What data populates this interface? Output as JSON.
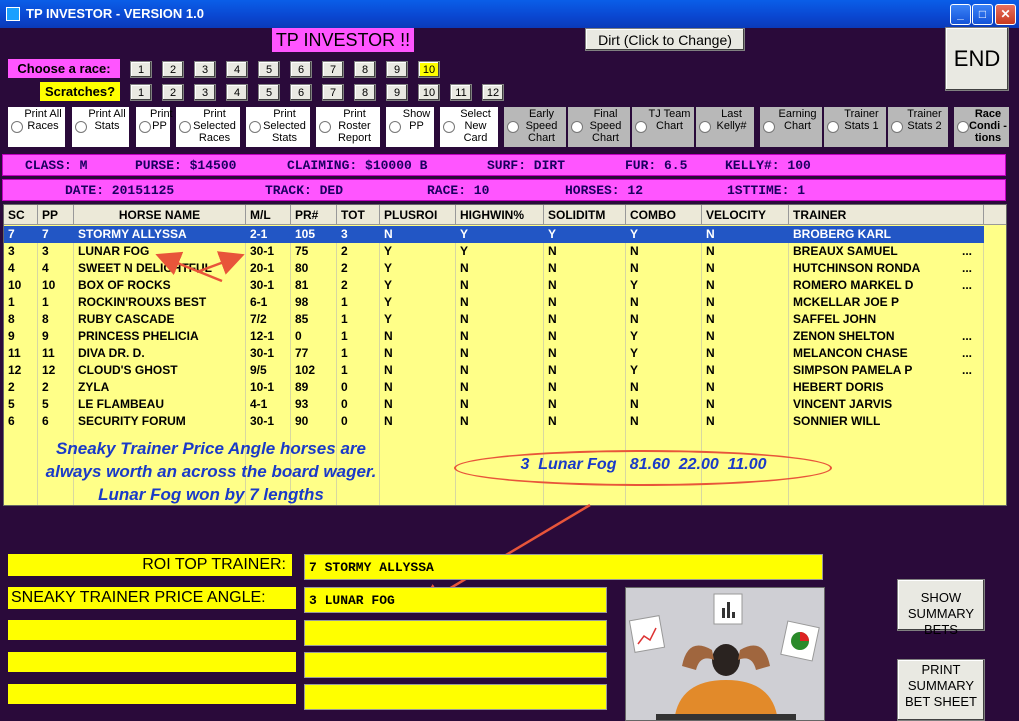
{
  "window": {
    "title": "TP INVESTOR - VERSION 1.0",
    "min": "_",
    "max": "□",
    "close": "✕"
  },
  "header": {
    "app_label": "TP INVESTOR !!",
    "dirt_button": "Dirt (Click to Change)",
    "end_button": "END",
    "choose_race_label": "Choose  a race:",
    "scratches_label": "Scratches?",
    "race_buttons": [
      "1",
      "2",
      "3",
      "4",
      "5",
      "6",
      "7",
      "8",
      "9",
      "10"
    ],
    "selected_race": "10",
    "scratch_buttons": [
      "1",
      "2",
      "3",
      "4",
      "5",
      "6",
      "7",
      "8",
      "9",
      "10",
      "11",
      "12"
    ]
  },
  "options": [
    {
      "label": "Print All Races"
    },
    {
      "label": "Print All Stats"
    },
    {
      "label": "Print PP"
    },
    {
      "label": "Print Selected Races"
    },
    {
      "label": "Print Selected Stats"
    },
    {
      "label": "Print Roster Report"
    },
    {
      "label": "Show PP"
    },
    {
      "label": "Select New Card"
    },
    {
      "label": "Early Speed Chart"
    },
    {
      "label": "Final Speed Chart"
    },
    {
      "label": "TJ Team Chart"
    },
    {
      "label": "Last Kelly#"
    },
    {
      "label": "Earning Chart"
    },
    {
      "label": "Trainer Stats 1"
    },
    {
      "label": "Trainer Stats 2"
    },
    {
      "label": "Race Condi -tions"
    }
  ],
  "info1": {
    "class": "CLASS: M",
    "purse": "PURSE: $14500",
    "claiming": "CLAIMING: $10000 B",
    "surf": "SURF: DIRT",
    "fur": "FUR: 6.5",
    "kelly": "KELLY#: 100"
  },
  "info2": {
    "date": "DATE: 20151125",
    "track": "TRACK: DED",
    "race": "RACE: 10",
    "horses": "HORSES: 12",
    "firsttime": "1STTIME: 1"
  },
  "grid": {
    "columns": [
      "SC",
      "PP",
      "HORSE NAME",
      "M/L",
      "PR#",
      "TOT",
      "PLUSROI",
      "HIGHWIN%",
      "SOLIDITM",
      "COMBO",
      "VELOCITY",
      "TRAINER"
    ],
    "rows": [
      [
        "7",
        "7",
        "STORMY ALLYSSA",
        "2-1",
        "105",
        "3",
        "N",
        "Y",
        "Y",
        "Y",
        "N",
        "BROBERG KARL",
        ""
      ],
      [
        "3",
        "3",
        "LUNAR FOG",
        "30-1",
        "75",
        "2",
        "Y",
        "Y",
        "N",
        "N",
        "N",
        "BREAUX SAMUEL",
        "..."
      ],
      [
        "4",
        "4",
        "SWEET N DELIGHTFUL",
        "20-1",
        "80",
        "2",
        "Y",
        "N",
        "N",
        "N",
        "N",
        "HUTCHINSON RONDA",
        "..."
      ],
      [
        "10",
        "10",
        "BOX OF ROCKS",
        "30-1",
        "81",
        "2",
        "Y",
        "N",
        "N",
        "Y",
        "N",
        "ROMERO MARKEL D",
        "..."
      ],
      [
        "1",
        "1",
        "ROCKIN'ROUXS BEST",
        "6-1",
        "98",
        "1",
        "Y",
        "N",
        "N",
        "N",
        "N",
        "MCKELLAR JOE P",
        ""
      ],
      [
        "8",
        "8",
        "RUBY CASCADE",
        "7/2",
        "85",
        "1",
        "Y",
        "N",
        "N",
        "N",
        "N",
        "SAFFEL JOHN",
        ""
      ],
      [
        "9",
        "9",
        "PRINCESS PHELICIA",
        "12-1",
        "0",
        "1",
        "N",
        "N",
        "N",
        "Y",
        "N",
        "ZENON SHELTON",
        "..."
      ],
      [
        "11",
        "11",
        "DIVA DR. D.",
        "30-1",
        "77",
        "1",
        "N",
        "N",
        "N",
        "Y",
        "N",
        "MELANCON CHASE",
        "..."
      ],
      [
        "12",
        "12",
        "CLOUD'S GHOST",
        "9/5",
        "102",
        "1",
        "N",
        "N",
        "N",
        "Y",
        "N",
        "SIMPSON PAMELA P",
        "..."
      ],
      [
        "2",
        "2",
        "ZYLA",
        "10-1",
        "89",
        "0",
        "N",
        "N",
        "N",
        "N",
        "N",
        "HEBERT DORIS",
        ""
      ],
      [
        "5",
        "5",
        "LE FLAMBEAU",
        "4-1",
        "93",
        "0",
        "N",
        "N",
        "N",
        "N",
        "N",
        "VINCENT JARVIS",
        ""
      ],
      [
        "6",
        "6",
        "SECURITY FORUM",
        "30-1",
        "90",
        "0",
        "N",
        "N",
        "N",
        "N",
        "N",
        "SONNIER WILL",
        ""
      ]
    ],
    "note": "Sneaky Trainer Price Angle horses are always worth an across the board wager. Lunar Fog won by 7 lengths",
    "payout": "3  Lunar Fog   81.60  22.00  11.00"
  },
  "bottom": {
    "roi_label": "ROI TOP TRAINER:",
    "roi_value": "7 STORMY ALLYSSA",
    "sneaky_label": "SNEAKY TRAINER PRICE ANGLE:",
    "sneaky_value": "3 LUNAR FOG",
    "show_summary": "SHOW SUMMARY BETS",
    "print_summary": "PRINT SUMMARY BET SHEET"
  },
  "colors": {
    "background": "#2a0a3a",
    "magenta": "#ff55ff",
    "yellow": "#ffff00",
    "grid": "#ffff88",
    "selection": "#2256c5",
    "annotation": "#e8553a"
  }
}
